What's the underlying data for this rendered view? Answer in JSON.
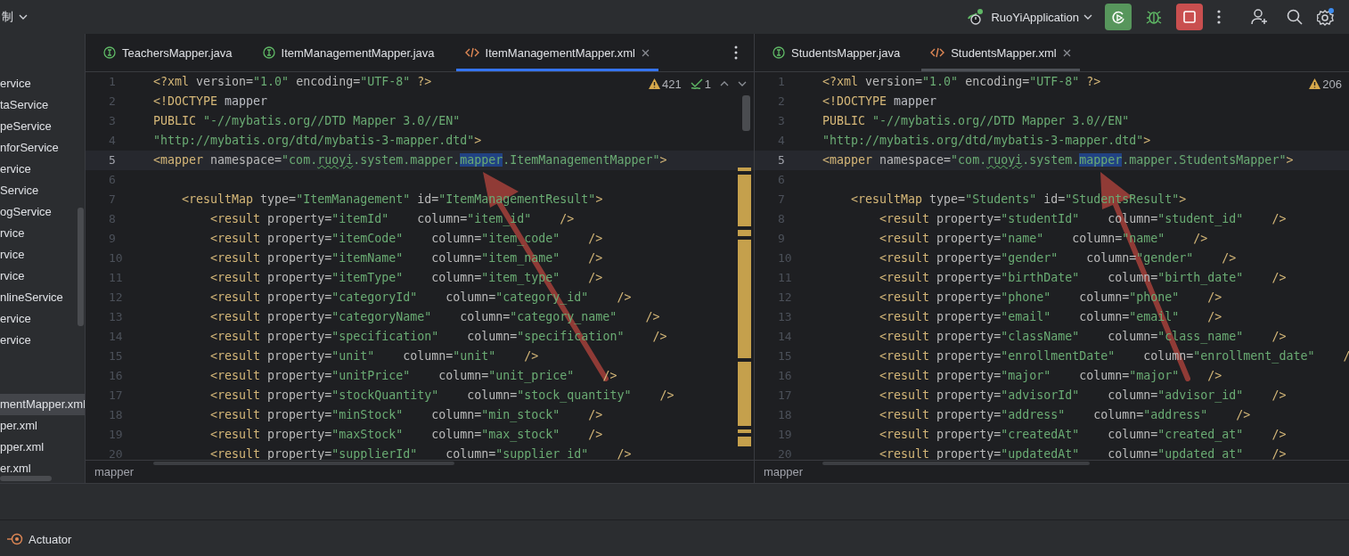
{
  "toolbar": {
    "project_menu": "制",
    "run_config": "RuoYiApplication"
  },
  "sidebar": {
    "groups": [
      [
        {
          "label": "ervice",
          "selected": false
        },
        {
          "label": "taService",
          "selected": false
        },
        {
          "label": "peService",
          "selected": false
        },
        {
          "label": "nforService",
          "selected": false
        },
        {
          "label": "ervice",
          "selected": false
        },
        {
          "label": "Service",
          "selected": false
        },
        {
          "label": "ogService",
          "selected": false
        },
        {
          "label": "rvice",
          "selected": false
        },
        {
          "label": "rvice",
          "selected": false
        },
        {
          "label": "rvice",
          "selected": false
        },
        {
          "label": "nlineService",
          "selected": false
        },
        {
          "label": "ervice",
          "selected": false
        },
        {
          "label": "ervice",
          "selected": false
        }
      ],
      [
        {
          "label": "mentMapper.xml",
          "selected": true
        },
        {
          "label": "per.xml",
          "selected": false
        },
        {
          "label": "pper.xml",
          "selected": false
        },
        {
          "label": "er.xml",
          "selected": false
        }
      ]
    ]
  },
  "editors": [
    {
      "focused": true,
      "tabs": [
        {
          "label": "TeachersMapper.java",
          "kind": "java",
          "selected": false
        },
        {
          "label": "ItemManagementMapper.java",
          "kind": "java",
          "selected": false
        },
        {
          "label": "ItemManagementMapper.xml",
          "kind": "xml",
          "selected": true
        }
      ],
      "warnings": "421",
      "checks": "1",
      "breadcrumb": "mapper",
      "lines": [
        {
          "n": "1",
          "current": false,
          "tokens": [
            {
              "kind": "tag",
              "t": "<?xml"
            },
            {
              "kind": "attr",
              "t": " version="
            },
            {
              "kind": "str",
              "t": "\"1.0\""
            },
            {
              "kind": "attr",
              "t": " encoding="
            },
            {
              "kind": "str",
              "t": "\"UTF-8\""
            },
            {
              "kind": "tag",
              "t": " ?>"
            }
          ]
        },
        {
          "n": "2",
          "current": false,
          "tokens": [
            {
              "kind": "tag",
              "t": "<!DOCTYPE"
            },
            {
              "kind": "plain",
              "t": " mapper"
            }
          ]
        },
        {
          "n": "3",
          "current": false,
          "tokens": [
            {
              "kind": "tag",
              "t": "PUBLIC"
            },
            {
              "kind": "str",
              "t": " \"-//mybatis.org//DTD Mapper 3.0//EN\""
            }
          ]
        },
        {
          "n": "4",
          "current": false,
          "tokens": [
            {
              "kind": "str",
              "t": "\"http://mybatis.org/dtd/mybatis-3-mapper.dtd\""
            },
            {
              "kind": "tag",
              "t": ">"
            }
          ]
        },
        {
          "n": "5",
          "current": true,
          "tokens": [
            {
              "kind": "tag",
              "t": "<mapper"
            },
            {
              "kind": "attr",
              "t": " namespace="
            },
            {
              "kind": "str",
              "t": "\"com."
            },
            {
              "kind": "typo",
              "t": "ruoyi"
            },
            {
              "kind": "str",
              "t": ".system.mapper."
            },
            {
              "kind": "sel",
              "t": "mapper"
            },
            {
              "kind": "str",
              "t": ".ItemManagementMapper\""
            },
            {
              "kind": "tag",
              "t": ">"
            }
          ]
        },
        {
          "n": "6",
          "current": false
        },
        {
          "n": "7",
          "current": false,
          "tokens": [
            {
              "kind": "tag",
              "t": "    <resultMap"
            },
            {
              "kind": "attr",
              "t": " type="
            },
            {
              "kind": "str",
              "t": "\"ItemManagement\""
            },
            {
              "kind": "attr",
              "t": " id="
            },
            {
              "kind": "str",
              "t": "\"ItemManagementResult\""
            },
            {
              "kind": "tag",
              "t": ">"
            }
          ]
        },
        {
          "n": "8",
          "current": false,
          "tokens": [
            {
              "kind": "tag",
              "t": "        <result"
            },
            {
              "kind": "attr",
              "t": " property="
            },
            {
              "kind": "str",
              "t": "\"itemId\""
            },
            {
              "kind": "attr",
              "t": "    column="
            },
            {
              "kind": "str",
              "t": "\"item_id\""
            },
            {
              "kind": "tag",
              "t": "    />"
            }
          ]
        },
        {
          "n": "9",
          "current": false,
          "tokens": [
            {
              "kind": "tag",
              "t": "        <result"
            },
            {
              "kind": "attr",
              "t": " property="
            },
            {
              "kind": "str",
              "t": "\"itemCode\""
            },
            {
              "kind": "attr",
              "t": "    column="
            },
            {
              "kind": "str",
              "t": "\"item_code\""
            },
            {
              "kind": "tag",
              "t": "    />"
            }
          ]
        },
        {
          "n": "10",
          "current": false,
          "tokens": [
            {
              "kind": "tag",
              "t": "        <result"
            },
            {
              "kind": "attr",
              "t": " property="
            },
            {
              "kind": "str",
              "t": "\"itemName\""
            },
            {
              "kind": "attr",
              "t": "    column="
            },
            {
              "kind": "str",
              "t": "\"item_name\""
            },
            {
              "kind": "tag",
              "t": "    />"
            }
          ]
        },
        {
          "n": "11",
          "current": false,
          "tokens": [
            {
              "kind": "tag",
              "t": "        <result"
            },
            {
              "kind": "attr",
              "t": " property="
            },
            {
              "kind": "str",
              "t": "\"itemType\""
            },
            {
              "kind": "attr",
              "t": "    column="
            },
            {
              "kind": "str",
              "t": "\"item_type\""
            },
            {
              "kind": "tag",
              "t": "    />"
            }
          ]
        },
        {
          "n": "12",
          "current": false,
          "tokens": [
            {
              "kind": "tag",
              "t": "        <result"
            },
            {
              "kind": "attr",
              "t": " property="
            },
            {
              "kind": "str",
              "t": "\"categoryId\""
            },
            {
              "kind": "attr",
              "t": "    column="
            },
            {
              "kind": "str",
              "t": "\"category_id\""
            },
            {
              "kind": "tag",
              "t": "    />"
            }
          ]
        },
        {
          "n": "13",
          "current": false,
          "tokens": [
            {
              "kind": "tag",
              "t": "        <result"
            },
            {
              "kind": "attr",
              "t": " property="
            },
            {
              "kind": "str",
              "t": "\"categoryName\""
            },
            {
              "kind": "attr",
              "t": "    column="
            },
            {
              "kind": "str",
              "t": "\"category_name\""
            },
            {
              "kind": "tag",
              "t": "    />"
            }
          ]
        },
        {
          "n": "14",
          "current": false,
          "tokens": [
            {
              "kind": "tag",
              "t": "        <result"
            },
            {
              "kind": "attr",
              "t": " property="
            },
            {
              "kind": "str",
              "t": "\"specification\""
            },
            {
              "kind": "attr",
              "t": "    column="
            },
            {
              "kind": "str",
              "t": "\"specification\""
            },
            {
              "kind": "tag",
              "t": "    />"
            }
          ]
        },
        {
          "n": "15",
          "current": false,
          "tokens": [
            {
              "kind": "tag",
              "t": "        <result"
            },
            {
              "kind": "attr",
              "t": " property="
            },
            {
              "kind": "str",
              "t": "\"unit\""
            },
            {
              "kind": "attr",
              "t": "    column="
            },
            {
              "kind": "str",
              "t": "\"unit\""
            },
            {
              "kind": "tag",
              "t": "    />"
            }
          ]
        },
        {
          "n": "16",
          "current": false,
          "tokens": [
            {
              "kind": "tag",
              "t": "        <result"
            },
            {
              "kind": "attr",
              "t": " property="
            },
            {
              "kind": "str",
              "t": "\"unitPrice\""
            },
            {
              "kind": "attr",
              "t": "    column="
            },
            {
              "kind": "str",
              "t": "\"unit_price\""
            },
            {
              "kind": "tag",
              "t": "    />"
            }
          ]
        },
        {
          "n": "17",
          "current": false,
          "tokens": [
            {
              "kind": "tag",
              "t": "        <result"
            },
            {
              "kind": "attr",
              "t": " property="
            },
            {
              "kind": "str",
              "t": "\"stockQuantity\""
            },
            {
              "kind": "attr",
              "t": "    column="
            },
            {
              "kind": "str",
              "t": "\"stock_quantity\""
            },
            {
              "kind": "tag",
              "t": "    />"
            }
          ]
        },
        {
          "n": "18",
          "current": false,
          "tokens": [
            {
              "kind": "tag",
              "t": "        <result"
            },
            {
              "kind": "attr",
              "t": " property="
            },
            {
              "kind": "str",
              "t": "\"minStock\""
            },
            {
              "kind": "attr",
              "t": "    column="
            },
            {
              "kind": "str",
              "t": "\"min_stock\""
            },
            {
              "kind": "tag",
              "t": "    />"
            }
          ]
        },
        {
          "n": "19",
          "current": false,
          "tokens": [
            {
              "kind": "tag",
              "t": "        <result"
            },
            {
              "kind": "attr",
              "t": " property="
            },
            {
              "kind": "str",
              "t": "\"maxStock\""
            },
            {
              "kind": "attr",
              "t": "    column="
            },
            {
              "kind": "str",
              "t": "\"max_stock\""
            },
            {
              "kind": "tag",
              "t": "    />"
            }
          ]
        },
        {
          "n": "20",
          "current": false,
          "tokens": [
            {
              "kind": "tag",
              "t": "        <result"
            },
            {
              "kind": "attr",
              "t": " property="
            },
            {
              "kind": "str",
              "t": "\"supplierId\""
            },
            {
              "kind": "attr",
              "t": "    column="
            },
            {
              "kind": "str",
              "t": "\"supplier_id\""
            },
            {
              "kind": "tag",
              "t": "    />"
            }
          ]
        }
      ]
    },
    {
      "focused": false,
      "tabs": [
        {
          "label": "StudentsMapper.java",
          "kind": "java",
          "selected": false
        },
        {
          "label": "StudentsMapper.xml",
          "kind": "xml",
          "selected": true
        }
      ],
      "warnings": "206",
      "breadcrumb": "mapper",
      "lines": [
        {
          "n": "1",
          "current": false,
          "tokens": [
            {
              "kind": "tag",
              "t": "<?xml"
            },
            {
              "kind": "attr",
              "t": " version="
            },
            {
              "kind": "str",
              "t": "\"1.0\""
            },
            {
              "kind": "attr",
              "t": " encoding="
            },
            {
              "kind": "str",
              "t": "\"UTF-8\""
            },
            {
              "kind": "tag",
              "t": " ?>"
            }
          ]
        },
        {
          "n": "2",
          "current": false,
          "tokens": [
            {
              "kind": "tag",
              "t": "<!DOCTYPE"
            },
            {
              "kind": "plain",
              "t": " mapper"
            }
          ]
        },
        {
          "n": "3",
          "current": false,
          "tokens": [
            {
              "kind": "tag",
              "t": "PUBLIC"
            },
            {
              "kind": "str",
              "t": " \"-//mybatis.org//DTD Mapper 3.0//EN\""
            }
          ]
        },
        {
          "n": "4",
          "current": false,
          "tokens": [
            {
              "kind": "str",
              "t": "\"http://mybatis.org/dtd/mybatis-3-mapper.dtd\""
            },
            {
              "kind": "tag",
              "t": ">"
            }
          ]
        },
        {
          "n": "5",
          "current": true,
          "tokens": [
            {
              "kind": "tag",
              "t": "<mapper"
            },
            {
              "kind": "attr",
              "t": " namespace="
            },
            {
              "kind": "str",
              "t": "\"com."
            },
            {
              "kind": "typo",
              "t": "ruoyi"
            },
            {
              "kind": "str",
              "t": ".system."
            },
            {
              "kind": "sel",
              "t": "mapper"
            },
            {
              "kind": "str",
              "t": ".mapper.StudentsMapper\""
            },
            {
              "kind": "tag",
              "t": ">"
            }
          ]
        },
        {
          "n": "6",
          "current": false
        },
        {
          "n": "7",
          "current": false,
          "tokens": [
            {
              "kind": "tag",
              "t": "    <resultMap"
            },
            {
              "kind": "attr",
              "t": " type="
            },
            {
              "kind": "str",
              "t": "\"Students\""
            },
            {
              "kind": "attr",
              "t": " id="
            },
            {
              "kind": "str",
              "t": "\"StudentsResult\""
            },
            {
              "kind": "tag",
              "t": ">"
            }
          ]
        },
        {
          "n": "8",
          "current": false,
          "tokens": [
            {
              "kind": "tag",
              "t": "        <result"
            },
            {
              "kind": "attr",
              "t": " property="
            },
            {
              "kind": "str",
              "t": "\"studentId\""
            },
            {
              "kind": "attr",
              "t": "    column="
            },
            {
              "kind": "str",
              "t": "\"student_id\""
            },
            {
              "kind": "tag",
              "t": "    />"
            }
          ]
        },
        {
          "n": "9",
          "current": false,
          "tokens": [
            {
              "kind": "tag",
              "t": "        <result"
            },
            {
              "kind": "attr",
              "t": " property="
            },
            {
              "kind": "str",
              "t": "\"name\""
            },
            {
              "kind": "attr",
              "t": "    column="
            },
            {
              "kind": "str",
              "t": "\"name\""
            },
            {
              "kind": "tag",
              "t": "    />"
            }
          ]
        },
        {
          "n": "10",
          "current": false,
          "tokens": [
            {
              "kind": "tag",
              "t": "        <result"
            },
            {
              "kind": "attr",
              "t": " property="
            },
            {
              "kind": "str",
              "t": "\"gender\""
            },
            {
              "kind": "attr",
              "t": "    column="
            },
            {
              "kind": "str",
              "t": "\"gender\""
            },
            {
              "kind": "tag",
              "t": "    />"
            }
          ]
        },
        {
          "n": "11",
          "current": false,
          "tokens": [
            {
              "kind": "tag",
              "t": "        <result"
            },
            {
              "kind": "attr",
              "t": " property="
            },
            {
              "kind": "str",
              "t": "\"birthDate\""
            },
            {
              "kind": "attr",
              "t": "    column="
            },
            {
              "kind": "str",
              "t": "\"birth_date\""
            },
            {
              "kind": "tag",
              "t": "    />"
            }
          ]
        },
        {
          "n": "12",
          "current": false,
          "tokens": [
            {
              "kind": "tag",
              "t": "        <result"
            },
            {
              "kind": "attr",
              "t": " property="
            },
            {
              "kind": "str",
              "t": "\"phone\""
            },
            {
              "kind": "attr",
              "t": "    column="
            },
            {
              "kind": "str",
              "t": "\"phone\""
            },
            {
              "kind": "tag",
              "t": "    />"
            }
          ]
        },
        {
          "n": "13",
          "current": false,
          "tokens": [
            {
              "kind": "tag",
              "t": "        <result"
            },
            {
              "kind": "attr",
              "t": " property="
            },
            {
              "kind": "str",
              "t": "\"email\""
            },
            {
              "kind": "attr",
              "t": "    column="
            },
            {
              "kind": "str",
              "t": "\"email\""
            },
            {
              "kind": "tag",
              "t": "    />"
            }
          ]
        },
        {
          "n": "14",
          "current": false,
          "tokens": [
            {
              "kind": "tag",
              "t": "        <result"
            },
            {
              "kind": "attr",
              "t": " property="
            },
            {
              "kind": "str",
              "t": "\"className\""
            },
            {
              "kind": "attr",
              "t": "    column="
            },
            {
              "kind": "str",
              "t": "\"class_name\""
            },
            {
              "kind": "tag",
              "t": "    />"
            }
          ]
        },
        {
          "n": "15",
          "current": false,
          "tokens": [
            {
              "kind": "tag",
              "t": "        <result"
            },
            {
              "kind": "attr",
              "t": " property="
            },
            {
              "kind": "str",
              "t": "\"enrollmentDate\""
            },
            {
              "kind": "attr",
              "t": "    column="
            },
            {
              "kind": "str",
              "t": "\"enrollment_date\""
            },
            {
              "kind": "tag",
              "t": "    /"
            }
          ]
        },
        {
          "n": "16",
          "current": false,
          "tokens": [
            {
              "kind": "tag",
              "t": "        <result"
            },
            {
              "kind": "attr",
              "t": " property="
            },
            {
              "kind": "str",
              "t": "\"major\""
            },
            {
              "kind": "attr",
              "t": "    column="
            },
            {
              "kind": "str",
              "t": "\"major\""
            },
            {
              "kind": "tag",
              "t": "    />"
            }
          ]
        },
        {
          "n": "17",
          "current": false,
          "tokens": [
            {
              "kind": "tag",
              "t": "        <result"
            },
            {
              "kind": "attr",
              "t": " property="
            },
            {
              "kind": "str",
              "t": "\"advisorId\""
            },
            {
              "kind": "attr",
              "t": "    column="
            },
            {
              "kind": "str",
              "t": "\"advisor_id\""
            },
            {
              "kind": "tag",
              "t": "    />"
            }
          ]
        },
        {
          "n": "18",
          "current": false,
          "tokens": [
            {
              "kind": "tag",
              "t": "        <result"
            },
            {
              "kind": "attr",
              "t": " property="
            },
            {
              "kind": "str",
              "t": "\"address\""
            },
            {
              "kind": "attr",
              "t": "    column="
            },
            {
              "kind": "str",
              "t": "\"address\""
            },
            {
              "kind": "tag",
              "t": "    />"
            }
          ]
        },
        {
          "n": "19",
          "current": false,
          "tokens": [
            {
              "kind": "tag",
              "t": "        <result"
            },
            {
              "kind": "attr",
              "t": " property="
            },
            {
              "kind": "str",
              "t": "\"createdAt\""
            },
            {
              "kind": "attr",
              "t": "    column="
            },
            {
              "kind": "str",
              "t": "\"created_at\""
            },
            {
              "kind": "tag",
              "t": "    />"
            }
          ]
        },
        {
          "n": "20",
          "current": false,
          "tokens": [
            {
              "kind": "tag",
              "t": "        <result"
            },
            {
              "kind": "attr",
              "t": " property="
            },
            {
              "kind": "str",
              "t": "\"updatedAt\""
            },
            {
              "kind": "attr",
              "t": "    column="
            },
            {
              "kind": "str",
              "t": "\"updated_at\""
            },
            {
              "kind": "tag",
              "t": "    />"
            }
          ]
        }
      ]
    }
  ],
  "bottom_bar": {
    "tool": "Actuator"
  }
}
